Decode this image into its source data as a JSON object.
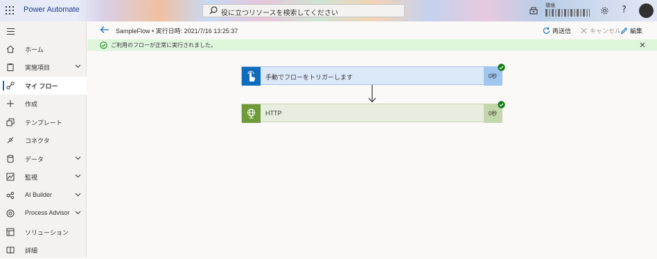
{
  "header": {
    "app_title": "Power Automate",
    "search_placeholder": "役に立つリソースを検索してください",
    "environment_label": "環境",
    "help_label": "?"
  },
  "sidebar": {
    "items": [
      {
        "label": "ホーム",
        "icon": "home-icon",
        "expandable": false,
        "active": false
      },
      {
        "label": "実施項目",
        "icon": "clipboard-icon",
        "expandable": true,
        "active": false
      },
      {
        "label": "マイ フロー",
        "icon": "flow-icon",
        "expandable": false,
        "active": true
      },
      {
        "label": "作成",
        "icon": "plus-icon",
        "expandable": false,
        "active": false
      },
      {
        "label": "テンプレート",
        "icon": "template-icon",
        "expandable": false,
        "active": false
      },
      {
        "label": "コネクタ",
        "icon": "connector-icon",
        "expandable": false,
        "active": false
      },
      {
        "label": "データ",
        "icon": "database-icon",
        "expandable": true,
        "active": false
      },
      {
        "label": "監視",
        "icon": "monitor-icon",
        "expandable": true,
        "active": false
      },
      {
        "label": "AI Builder",
        "icon": "ai-builder-icon",
        "expandable": true,
        "active": false
      },
      {
        "label": "Process Advisor",
        "icon": "process-advisor-icon",
        "expandable": true,
        "active": false
      },
      {
        "label": "ソリューション",
        "icon": "solution-icon",
        "expandable": false,
        "active": false
      },
      {
        "label": "詳細",
        "icon": "book-icon",
        "expandable": false,
        "active": false
      }
    ]
  },
  "command_bar": {
    "flow_title": "SampleFlow • 実行日時: 2021/7/16 13:25:37",
    "resend_label": "再送信",
    "cancel_label": "キャンセル",
    "edit_label": "編集"
  },
  "banner": {
    "message": "ご利用のフローが正常に実行されました。"
  },
  "steps": [
    {
      "name": "手動でフローをトリガーします",
      "duration": "0秒",
      "icon": "touch-trigger-icon",
      "status": "success"
    },
    {
      "name": "HTTP",
      "duration": "0秒",
      "icon": "globe-icon",
      "status": "success"
    }
  ],
  "colors": {
    "accent": "#0f6cbd",
    "success": "#107c10",
    "banner_bg": "#dff6dd",
    "trigger_icon_bg": "#0f6cbd",
    "http_icon_bg": "#6e9a3a"
  }
}
